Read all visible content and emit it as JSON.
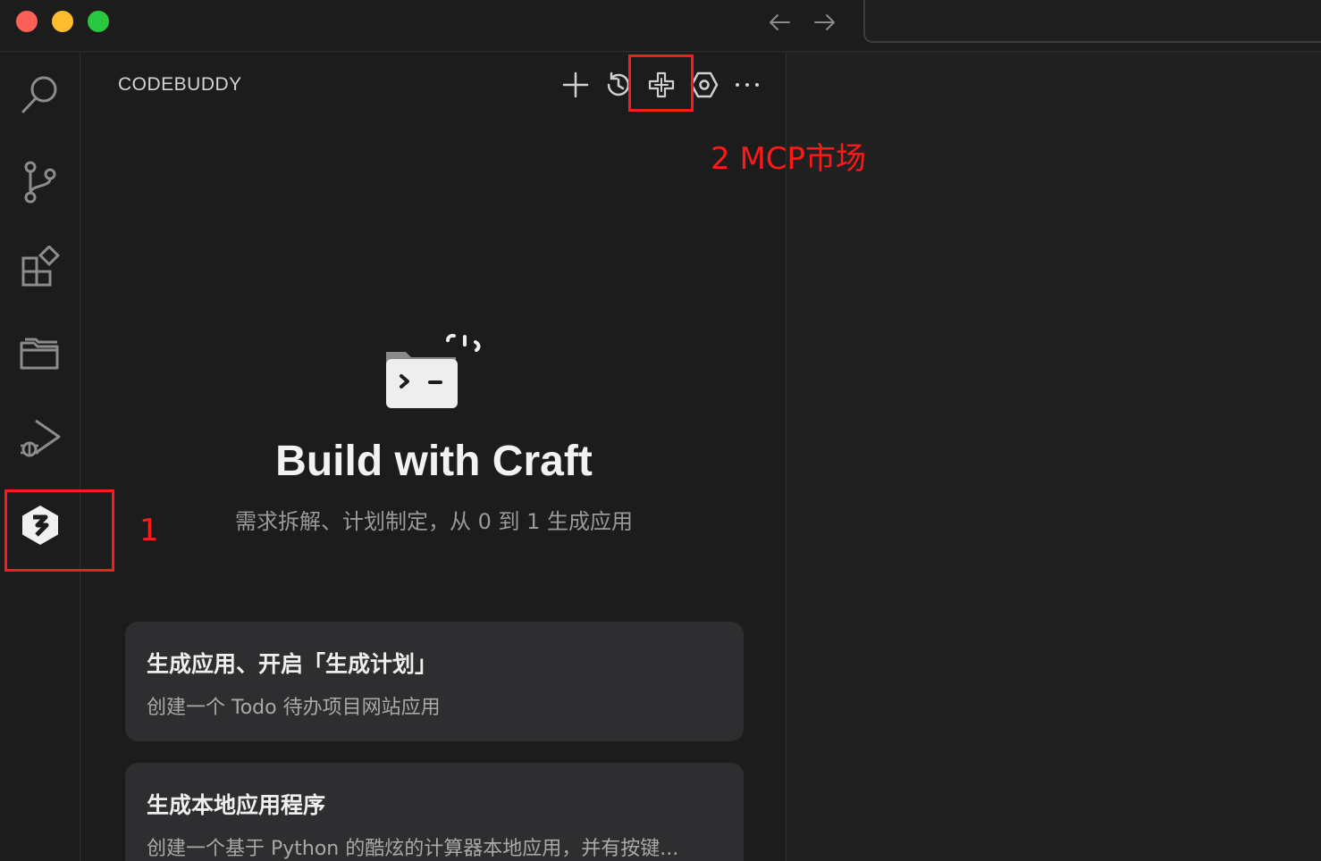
{
  "window": {
    "traffic_lights": [
      "close",
      "minimize",
      "maximize"
    ],
    "colors": {
      "close": "#fe5f57",
      "minimize": "#febc2e",
      "maximize": "#28c840"
    }
  },
  "activity_bar": {
    "items": [
      {
        "icon": "search-icon"
      },
      {
        "icon": "source-control-icon"
      },
      {
        "icon": "extensions-icon"
      },
      {
        "icon": "folder-icon"
      },
      {
        "icon": "run-debug-icon"
      },
      {
        "icon": "codebuddy-logo-icon",
        "active": true
      }
    ]
  },
  "sidebar": {
    "title": "CODEBUDDY",
    "toolbar": [
      {
        "icon": "plus-icon"
      },
      {
        "icon": "history-icon"
      },
      {
        "icon": "mcp-market-icon"
      },
      {
        "icon": "settings-icon"
      },
      {
        "icon": "more-icon"
      }
    ]
  },
  "hero": {
    "title": "Build with Craft",
    "subtitle": "需求拆解、计划制定，从 0 到 1 生成应用"
  },
  "cards": [
    {
      "title": "生成应用、开启「生成计划」",
      "desc": "创建一个 Todo 待办项目网站应用"
    },
    {
      "title": "生成本地应用程序",
      "desc": "创建一个基于 Python 的酷炫的计算器本地应用，并有按键..."
    }
  ],
  "annotations": {
    "label_1": "1",
    "label_2": "2 MCP市场",
    "color": "#ff1a1a"
  }
}
